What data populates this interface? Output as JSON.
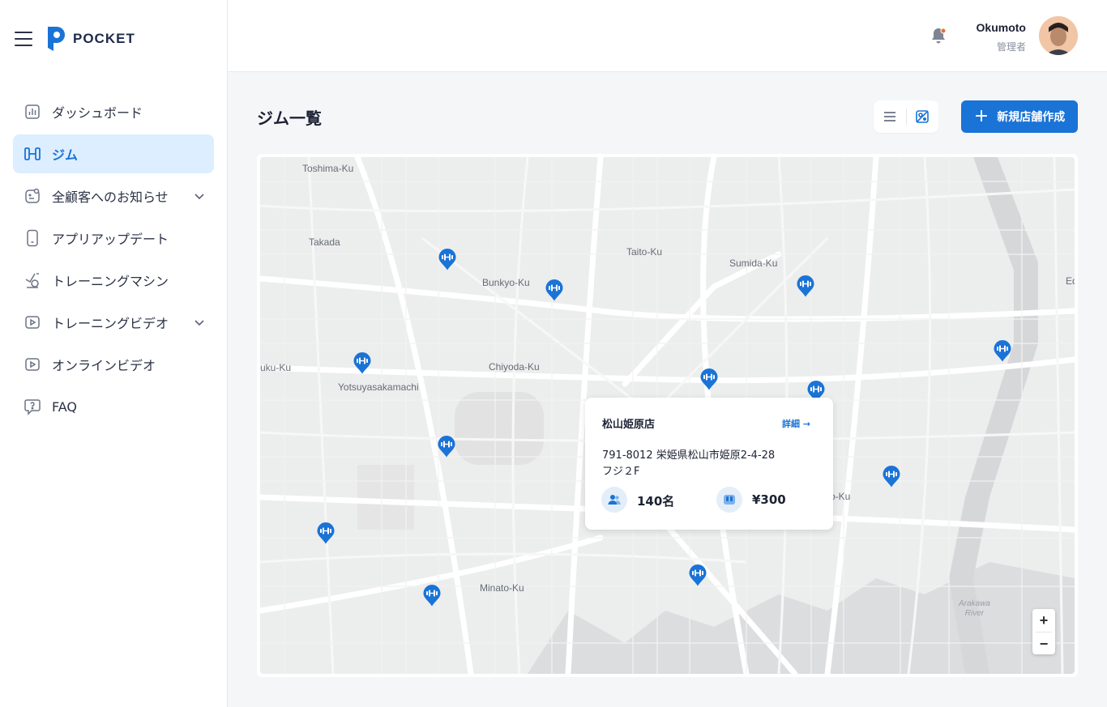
{
  "brand": {
    "name": "POCKET"
  },
  "sidebar": {
    "items": [
      {
        "label": "ダッシュボード",
        "icon": "bar-chart-icon"
      },
      {
        "label": "ジム",
        "icon": "gym-icon",
        "active": true
      },
      {
        "label": "全顧客へのお知らせ",
        "icon": "notice-icon",
        "expandable": true
      },
      {
        "label": "アプリアップデート",
        "icon": "phone-icon"
      },
      {
        "label": "トレーニングマシン",
        "icon": "bike-icon"
      },
      {
        "label": "トレーニングビデオ",
        "icon": "video-icon",
        "expandable": true
      },
      {
        "label": "オンラインビデオ",
        "icon": "video-icon"
      },
      {
        "label": "FAQ",
        "icon": "faq-icon"
      }
    ]
  },
  "header": {
    "user": {
      "name": "Okumoto",
      "role": "管理者"
    },
    "notification_dot_color": "#f26b2a"
  },
  "main": {
    "title": "ジム一覧",
    "new_button_label": "新規店舗作成"
  },
  "map": {
    "labels": {
      "toshima": "Toshima-Ku",
      "takada": "Takada",
      "bunkyo": "Bunkyo-Ku",
      "taito": "Taito-Ku",
      "sumida": "Sumida-Ku",
      "edge_e": "Ed",
      "shinjuku": "uku-Ku",
      "yotsuya": "Yotsuyasakamachi",
      "chiyoda": "Chiyoda-Ku",
      "koto": "o-Ku",
      "minato": "Minato-Ku",
      "arakawa": "Arakawa",
      "river": "River"
    },
    "popup": {
      "name": "松山姫原店",
      "link": "詳細 →",
      "address_line1": "791-8012 栄姫県松山市姫原2-4-28",
      "address_line2": "フジ２F",
      "members": "140名",
      "price": "¥300"
    },
    "zoom_in": "+",
    "zoom_out": "−"
  },
  "colors": {
    "accent": "#1a73d6",
    "active_bg": "#dceeff"
  }
}
